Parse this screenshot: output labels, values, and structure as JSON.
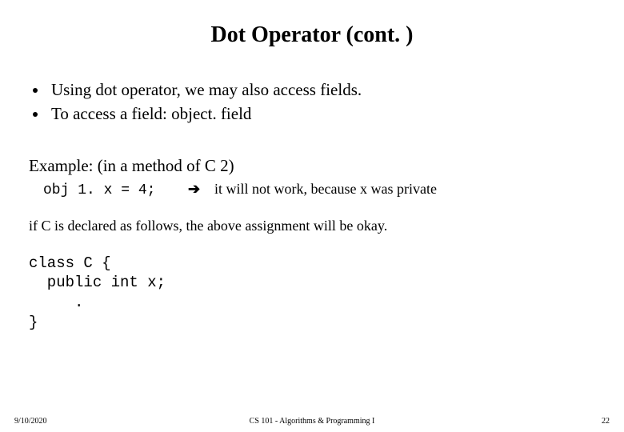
{
  "title": "Dot Operator (cont. )",
  "bullets": [
    "Using dot operator, we may also access fields.",
    "To access a field:   object. field"
  ],
  "example_label": "Example: (in a method of C 2)",
  "code_stmt": "obj 1. x = 4;",
  "arrow": "➔",
  "note": "it will not work, because x was private",
  "followup": "if C is declared as follows, the above assignment will be okay.",
  "code_block": "class C {\n  public int x;\n     .\n}",
  "footer": {
    "date": "9/10/2020",
    "course": "CS 101 - Algorithms & Programming I",
    "page": "22"
  }
}
